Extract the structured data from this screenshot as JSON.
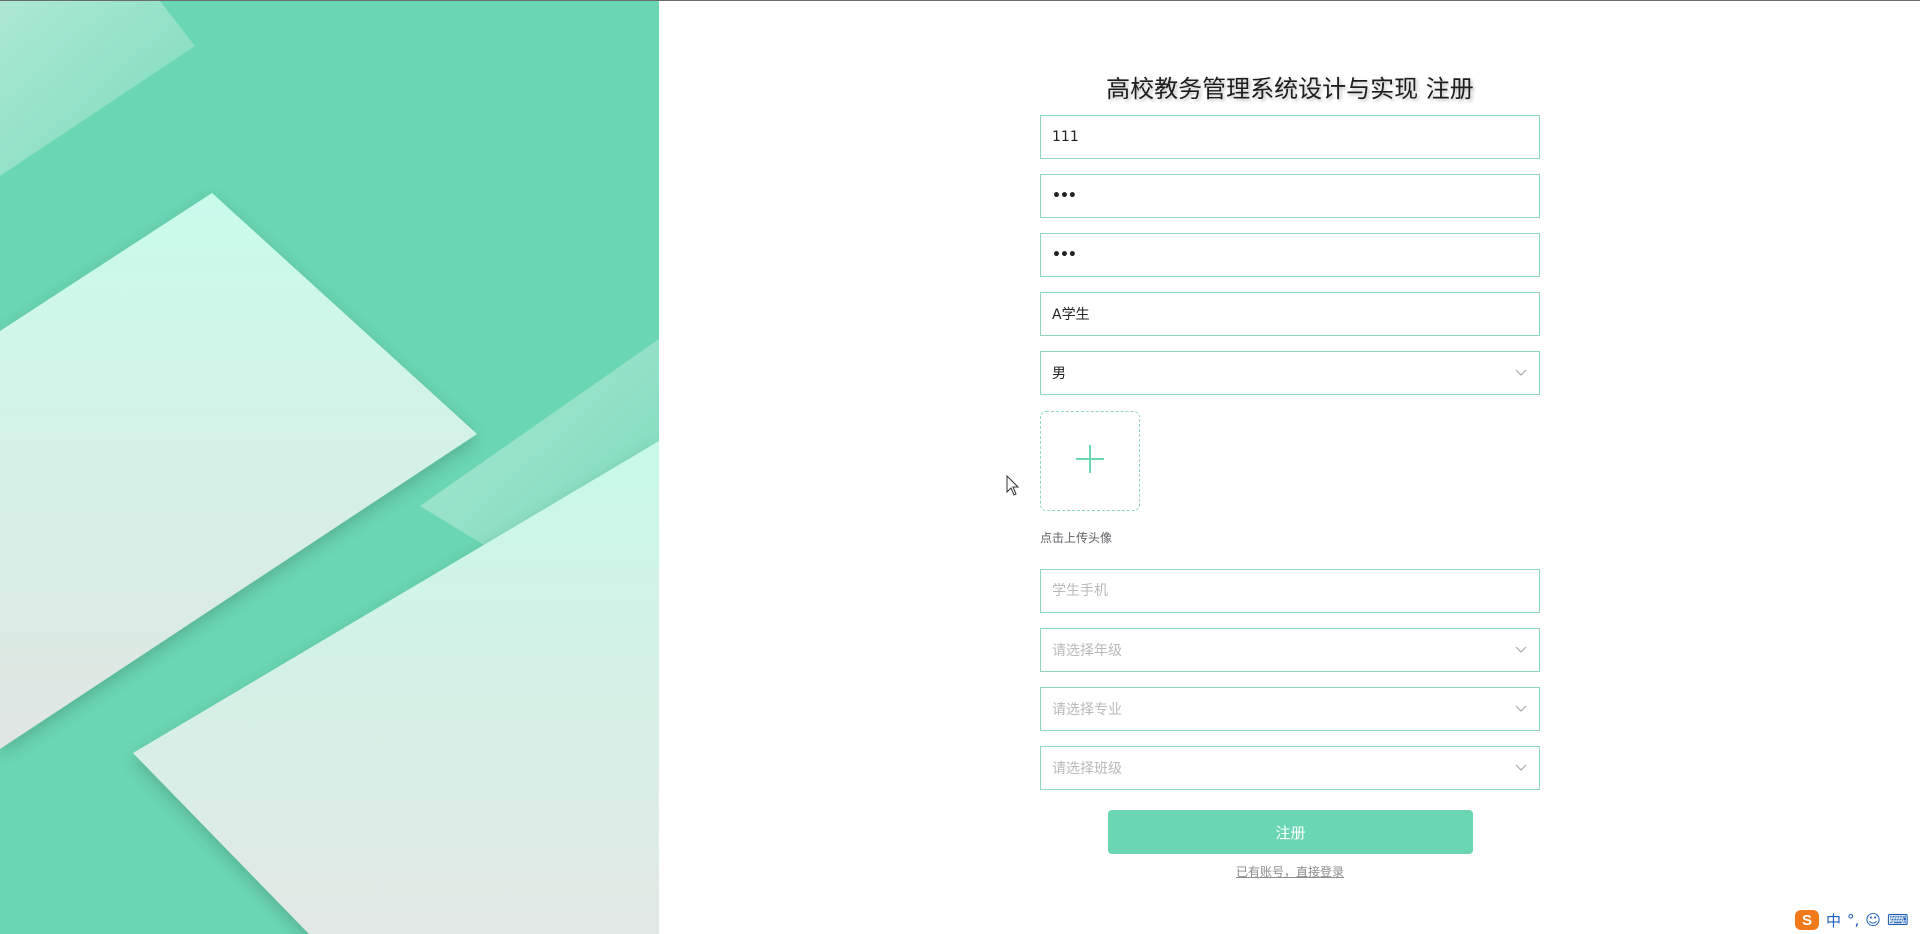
{
  "form": {
    "title": "高校教务管理系统设计与实现 注册",
    "account_value": "111",
    "password_value": "•••",
    "confirm_password_value": "•••",
    "name_value": "A学生",
    "gender_value": "男",
    "upload_hint": "点击上传头像",
    "phone_placeholder": "学生手机",
    "grade_placeholder": "请选择年级",
    "major_placeholder": "请选择专业",
    "class_placeholder": "请选择班级",
    "submit_label": "注册",
    "login_link": "已有账号，直接登录"
  },
  "ime": {
    "logo": "S",
    "mode": "中",
    "punct": "°,",
    "emoji": "☺",
    "keyboard": "⌨"
  },
  "colors": {
    "accent": "#6ad6b3",
    "border": "#8fd8bf",
    "placeholder": "#b9b9b9",
    "ime_blue": "#1b5fb8",
    "ime_orange": "#f07a1a"
  }
}
